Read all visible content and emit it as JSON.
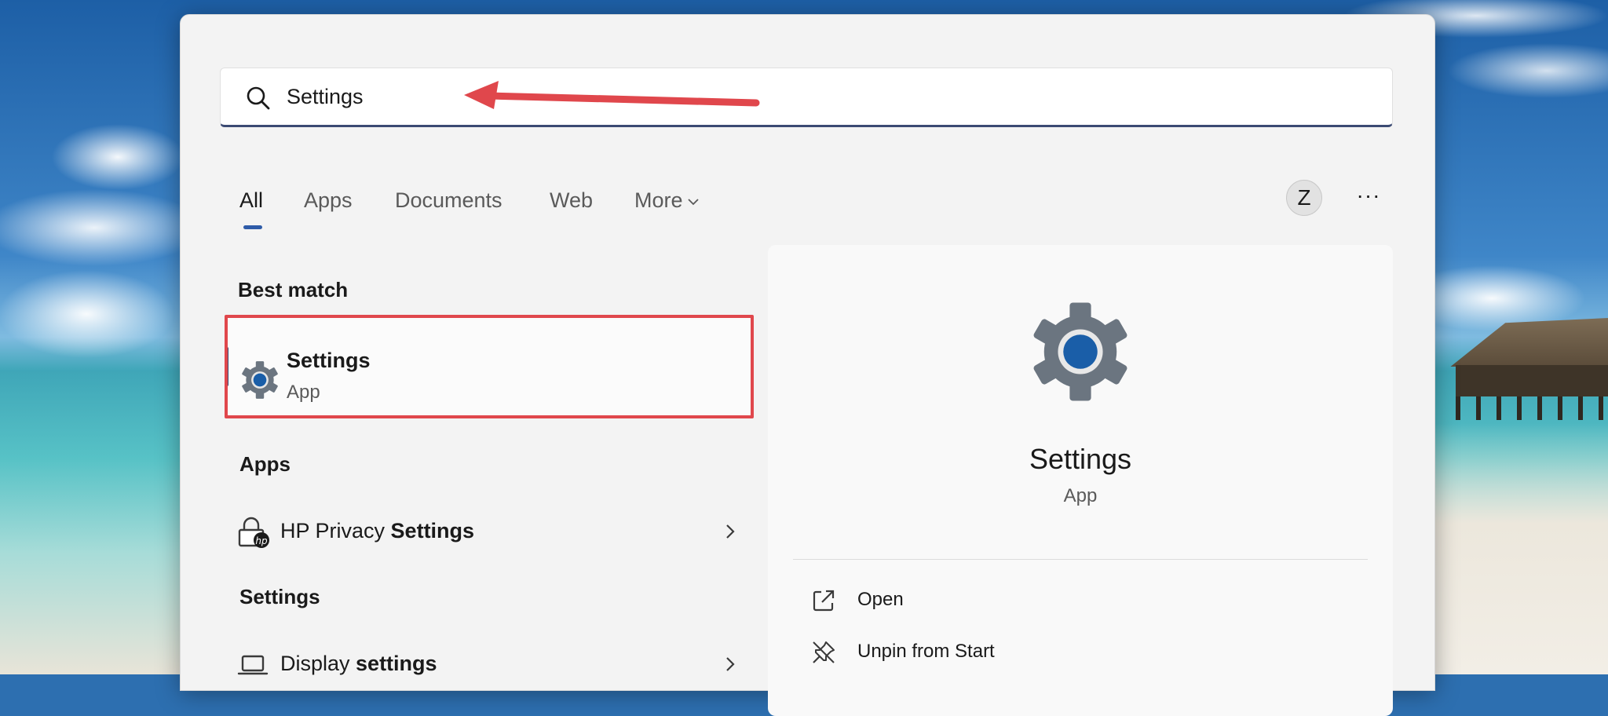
{
  "search": {
    "query": "Settings"
  },
  "tabs": [
    {
      "label": "All"
    },
    {
      "label": "Apps"
    },
    {
      "label": "Documents"
    },
    {
      "label": "Web"
    },
    {
      "label": "More"
    }
  ],
  "user": {
    "avatar_initial": "Z"
  },
  "more_options_label": "···",
  "best_match": {
    "heading": "Best match",
    "title": "Settings",
    "subtitle": "App"
  },
  "apps_section": {
    "heading": "Apps",
    "items": [
      {
        "prefix": "HP Privacy ",
        "match": "Settings"
      }
    ]
  },
  "settings_section": {
    "heading": "Settings",
    "items": [
      {
        "prefix": "Display ",
        "match": "settings"
      }
    ]
  },
  "preview": {
    "name": "Settings",
    "type": "App",
    "actions": [
      {
        "label": "Open",
        "icon": "open-external-icon"
      },
      {
        "label": "Unpin from Start",
        "icon": "unpin-icon"
      }
    ]
  },
  "colors": {
    "accent": "#3b4a73",
    "annotation_red": "#e0474c",
    "gear_blue": "#1a5ea8",
    "gear_gray": "#6b7580"
  }
}
